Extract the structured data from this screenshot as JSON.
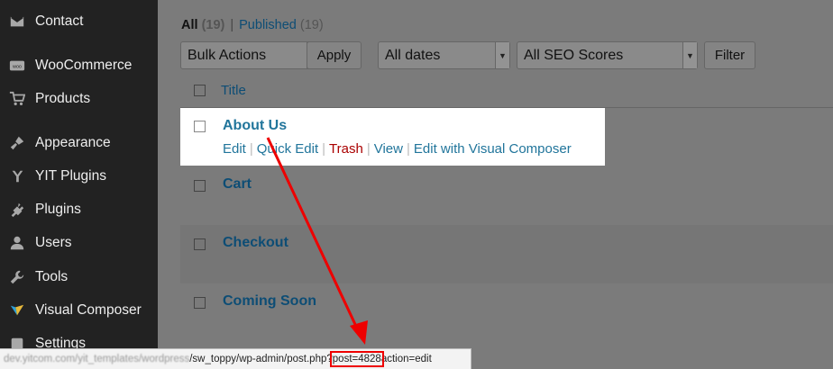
{
  "sidebar": {
    "items": [
      {
        "label": "Contact",
        "icon": "envelope-icon"
      },
      {
        "label": "WooCommerce",
        "icon": "woocommerce-icon"
      },
      {
        "label": "Products",
        "icon": "cart-icon"
      },
      {
        "label": "Appearance",
        "icon": "paintbrush-icon"
      },
      {
        "label": "YIT Plugins",
        "icon": "yit-icon"
      },
      {
        "label": "Plugins",
        "icon": "plug-icon"
      },
      {
        "label": "Users",
        "icon": "user-icon"
      },
      {
        "label": "Tools",
        "icon": "wrench-icon"
      },
      {
        "label": "Visual Composer",
        "icon": "visual-composer-icon"
      },
      {
        "label": "Settings",
        "icon": "settings-icon"
      }
    ]
  },
  "filters": {
    "all_label": "All",
    "all_count": "(19)",
    "separator": "|",
    "published_label": "Published",
    "published_count": "(19)"
  },
  "toolbar": {
    "bulk_actions": "Bulk Actions",
    "apply": "Apply",
    "dates": "All dates",
    "seo": "All SEO Scores",
    "filter": "Filter"
  },
  "table": {
    "column_title": "Title",
    "rows": [
      {
        "title": "About Us",
        "actions": [
          "Edit",
          "Quick Edit",
          "Trash",
          "View",
          "Edit with Visual Composer"
        ]
      },
      {
        "title": "Cart"
      },
      {
        "title": "Checkout"
      },
      {
        "title": "Coming Soon"
      }
    ]
  },
  "status_bar": {
    "url_host": "dev.yitcom.com/yit_templates/wordpress",
    "url_path": "/sw_toppy/wp-admin/post.php?",
    "url_param": "post=4828",
    "url_rest": "action=edit"
  },
  "colors": {
    "annotation": "#ee0000",
    "link": "#21759b",
    "trash": "#aa0000",
    "sidebar_bg": "#222222"
  }
}
